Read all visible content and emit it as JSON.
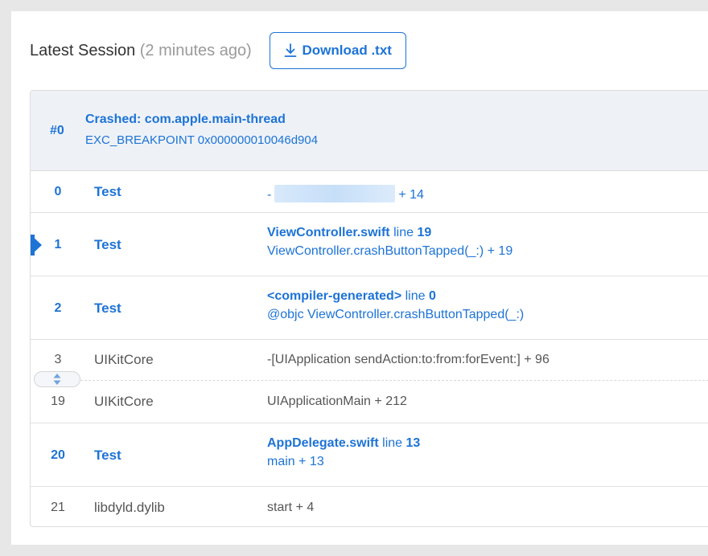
{
  "header": {
    "title": "Latest Session",
    "subtitle": "(2 minutes ago)",
    "download_label": "Download .txt"
  },
  "thread": {
    "number": "#0",
    "name": "Crashed: com.apple.main-thread",
    "reason": "EXC_BREAKPOINT 0x000000010046d904"
  },
  "frames": [
    {
      "index": "0",
      "library": "Test",
      "prefix": "-",
      "offset": "+ 14"
    },
    {
      "index": "1",
      "library": "Test",
      "file": "ViewController.swift",
      "line_word": "line",
      "line_no": "19",
      "symbol": "ViewController.crashButtonTapped(_:) + 19"
    },
    {
      "index": "2",
      "library": "Test",
      "file": "<compiler-generated>",
      "line_word": "line",
      "line_no": "0",
      "symbol": "@objc ViewController.crashButtonTapped(_:)"
    },
    {
      "index": "3",
      "library": "UIKitCore",
      "symbol": "-[UIApplication sendAction:to:from:forEvent:] + 96"
    },
    {
      "index": "19",
      "library": "UIKitCore",
      "symbol": "UIApplicationMain + 212"
    },
    {
      "index": "20",
      "library": "Test",
      "file": "AppDelegate.swift",
      "line_word": "line",
      "line_no": "13",
      "symbol": "main + 13"
    },
    {
      "index": "21",
      "library": "libdyld.dylib",
      "symbol": "start + 4"
    }
  ],
  "colors": {
    "accent": "#1d73d6",
    "thread_bg": "#eef2f7",
    "muted": "#555555"
  }
}
